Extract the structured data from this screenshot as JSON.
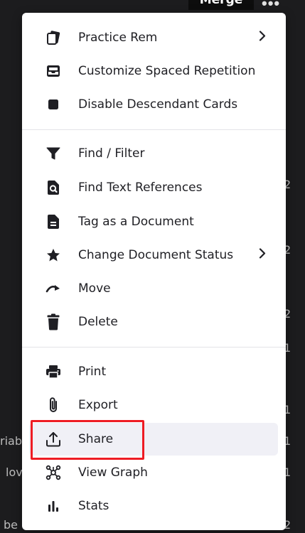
{
  "header": {
    "merge_label": "Merge",
    "more_label": "•••"
  },
  "background_fragments": {
    "left": [
      "riab",
      "lov",
      "be"
    ],
    "right": [
      "2",
      "2",
      "2",
      "1",
      "1",
      "1",
      "1",
      "2"
    ]
  },
  "menu": {
    "section1": [
      {
        "label": "Practice Rem",
        "icon": "cards-icon",
        "submenu": true
      },
      {
        "label": "Customize Spaced Repetition",
        "icon": "inbox-tray-icon",
        "submenu": false
      },
      {
        "label": "Disable Descendant Cards",
        "icon": "stop-square-icon",
        "submenu": false
      }
    ],
    "section2": [
      {
        "label": "Find / Filter",
        "icon": "filter-funnel-icon",
        "submenu": false
      },
      {
        "label": "Find Text References",
        "icon": "document-search-icon",
        "submenu": false
      },
      {
        "label": "Tag as a Document",
        "icon": "document-icon",
        "submenu": false
      },
      {
        "label": "Change Document Status",
        "icon": "star-icon",
        "submenu": true
      },
      {
        "label": "Move",
        "icon": "move-arrow-icon",
        "submenu": false
      },
      {
        "label": "Delete",
        "icon": "trash-icon",
        "submenu": false
      }
    ],
    "section3": [
      {
        "label": "Print",
        "icon": "printer-icon",
        "submenu": false
      },
      {
        "label": "Export",
        "icon": "paperclip-icon",
        "submenu": false
      },
      {
        "label": "Share",
        "icon": "share-upload-icon",
        "submenu": false,
        "hovered": true
      },
      {
        "label": "View Graph",
        "icon": "graph-nodes-icon",
        "submenu": false
      },
      {
        "label": "Stats",
        "icon": "bar-stats-icon",
        "submenu": false
      }
    ]
  },
  "colors": {
    "menu_bg": "#ffffff",
    "text": "#1f1f24",
    "icon": "#1f1f24",
    "hover_bg": "#f0f0f6",
    "annotation": "#ee1c24",
    "page_bg": "#1c1c1e"
  }
}
